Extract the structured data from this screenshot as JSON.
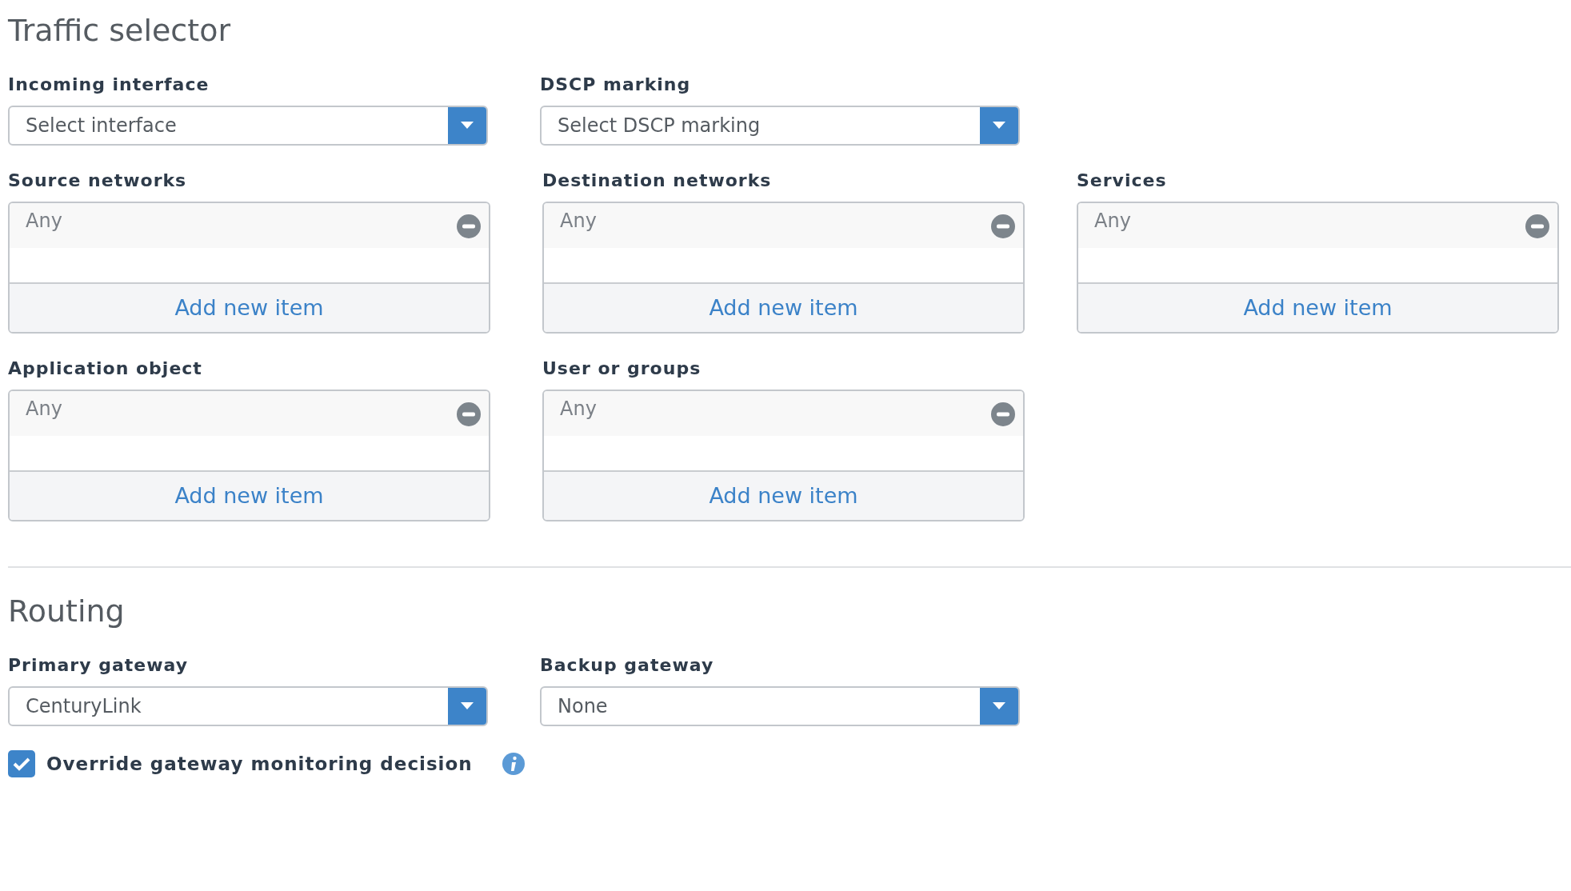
{
  "sections": [
    {
      "title": "Traffic selector",
      "rows": [
        [
          {
            "kind": "select",
            "label": "Incoming interface",
            "placeholder": "Select interface"
          },
          {
            "kind": "select",
            "label": "DSCP marking",
            "placeholder": "Select DSCP marking"
          }
        ],
        [
          {
            "kind": "list",
            "label": "Source networks",
            "items": [
              "Any"
            ],
            "add_label": "Add new item"
          },
          {
            "kind": "list",
            "label": "Destination networks",
            "items": [
              "Any"
            ],
            "add_label": "Add new item"
          },
          {
            "kind": "list",
            "label": "Services",
            "items": [
              "Any"
            ],
            "add_label": "Add new item"
          }
        ],
        [
          {
            "kind": "list",
            "label": "Application object",
            "items": [
              "Any"
            ],
            "add_label": "Add new item"
          },
          {
            "kind": "list",
            "label": "User or groups",
            "items": [
              "Any"
            ],
            "add_label": "Add new item"
          }
        ]
      ]
    },
    {
      "title": "Routing",
      "rows": [
        [
          {
            "kind": "select",
            "label": "Primary gateway",
            "value": "CenturyLink"
          },
          {
            "kind": "select",
            "label": "Backup gateway",
            "value": "None"
          }
        ],
        [
          {
            "kind": "checkbox",
            "label": "Override gateway monitoring decision",
            "checked": true
          }
        ]
      ]
    }
  ]
}
